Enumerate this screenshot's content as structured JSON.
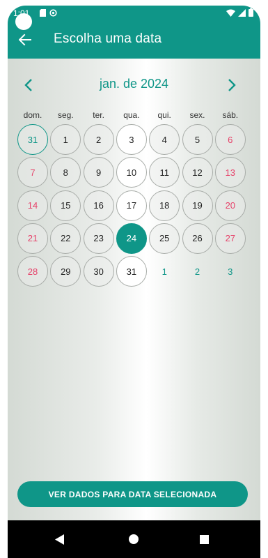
{
  "status_bar": {
    "time": "1:01"
  },
  "app_bar": {
    "title": "Escolha uma data"
  },
  "calendar": {
    "month_label": "jan. de 2024",
    "weekdays": [
      "dom.",
      "seg.",
      "ter.",
      "qua.",
      "qui.",
      "sex.",
      "sáb."
    ],
    "days": [
      {
        "label": "31",
        "style": "today"
      },
      {
        "label": "1",
        "style": "normal"
      },
      {
        "label": "2",
        "style": "normal"
      },
      {
        "label": "3",
        "style": "white"
      },
      {
        "label": "4",
        "style": "normal"
      },
      {
        "label": "5",
        "style": "normal"
      },
      {
        "label": "6",
        "style": "weekend"
      },
      {
        "label": "7",
        "style": "weekend"
      },
      {
        "label": "8",
        "style": "normal"
      },
      {
        "label": "9",
        "style": "normal"
      },
      {
        "label": "10",
        "style": "white"
      },
      {
        "label": "11",
        "style": "normal"
      },
      {
        "label": "12",
        "style": "normal"
      },
      {
        "label": "13",
        "style": "weekend"
      },
      {
        "label": "14",
        "style": "weekend"
      },
      {
        "label": "15",
        "style": "normal"
      },
      {
        "label": "16",
        "style": "normal"
      },
      {
        "label": "17",
        "style": "white"
      },
      {
        "label": "18",
        "style": "normal"
      },
      {
        "label": "19",
        "style": "normal"
      },
      {
        "label": "20",
        "style": "weekend"
      },
      {
        "label": "21",
        "style": "weekend"
      },
      {
        "label": "22",
        "style": "normal"
      },
      {
        "label": "23",
        "style": "normal"
      },
      {
        "label": "24",
        "style": "selected"
      },
      {
        "label": "25",
        "style": "normal"
      },
      {
        "label": "26",
        "style": "normal"
      },
      {
        "label": "27",
        "style": "weekend"
      },
      {
        "label": "28",
        "style": "weekend"
      },
      {
        "label": "29",
        "style": "normal"
      },
      {
        "label": "30",
        "style": "normal"
      },
      {
        "label": "31",
        "style": "white"
      },
      {
        "label": "1",
        "style": "outside"
      },
      {
        "label": "2",
        "style": "outside"
      },
      {
        "label": "3",
        "style": "outside"
      }
    ]
  },
  "action_button": {
    "label": "VER DADOS PARA DATA SELECIONADA"
  },
  "colors": {
    "accent": "#0f9688",
    "weekend": "#e6426a"
  },
  "icons": {
    "back": "arrow-left-icon",
    "prev": "chevron-left-icon",
    "next": "chevron-right-icon",
    "nav_back": "triangle-back-icon",
    "nav_home": "circle-home-icon",
    "nav_recents": "square-recents-icon"
  }
}
